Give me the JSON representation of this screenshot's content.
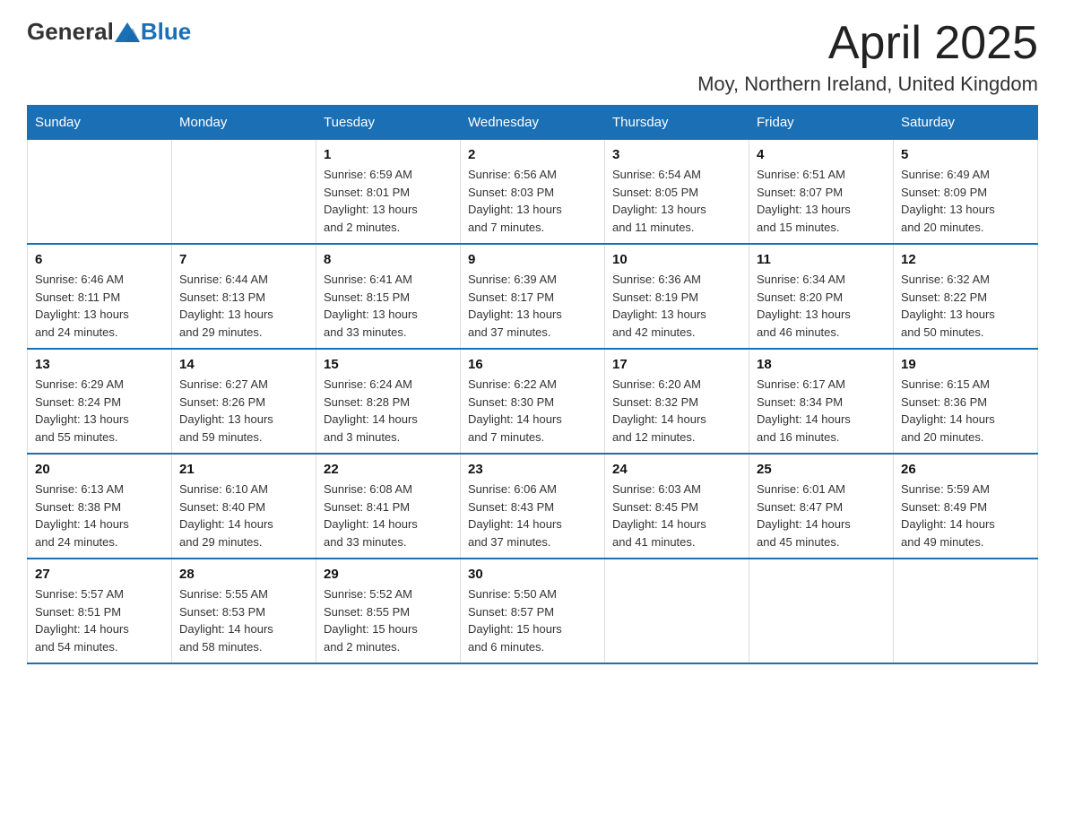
{
  "logo": {
    "text_general": "General",
    "text_blue": "Blue"
  },
  "header": {
    "title": "April 2025",
    "subtitle": "Moy, Northern Ireland, United Kingdom"
  },
  "weekdays": [
    "Sunday",
    "Monday",
    "Tuesday",
    "Wednesday",
    "Thursday",
    "Friday",
    "Saturday"
  ],
  "weeks": [
    [
      {
        "day": "",
        "info": ""
      },
      {
        "day": "",
        "info": ""
      },
      {
        "day": "1",
        "info": "Sunrise: 6:59 AM\nSunset: 8:01 PM\nDaylight: 13 hours\nand 2 minutes."
      },
      {
        "day": "2",
        "info": "Sunrise: 6:56 AM\nSunset: 8:03 PM\nDaylight: 13 hours\nand 7 minutes."
      },
      {
        "day": "3",
        "info": "Sunrise: 6:54 AM\nSunset: 8:05 PM\nDaylight: 13 hours\nand 11 minutes."
      },
      {
        "day": "4",
        "info": "Sunrise: 6:51 AM\nSunset: 8:07 PM\nDaylight: 13 hours\nand 15 minutes."
      },
      {
        "day": "5",
        "info": "Sunrise: 6:49 AM\nSunset: 8:09 PM\nDaylight: 13 hours\nand 20 minutes."
      }
    ],
    [
      {
        "day": "6",
        "info": "Sunrise: 6:46 AM\nSunset: 8:11 PM\nDaylight: 13 hours\nand 24 minutes."
      },
      {
        "day": "7",
        "info": "Sunrise: 6:44 AM\nSunset: 8:13 PM\nDaylight: 13 hours\nand 29 minutes."
      },
      {
        "day": "8",
        "info": "Sunrise: 6:41 AM\nSunset: 8:15 PM\nDaylight: 13 hours\nand 33 minutes."
      },
      {
        "day": "9",
        "info": "Sunrise: 6:39 AM\nSunset: 8:17 PM\nDaylight: 13 hours\nand 37 minutes."
      },
      {
        "day": "10",
        "info": "Sunrise: 6:36 AM\nSunset: 8:19 PM\nDaylight: 13 hours\nand 42 minutes."
      },
      {
        "day": "11",
        "info": "Sunrise: 6:34 AM\nSunset: 8:20 PM\nDaylight: 13 hours\nand 46 minutes."
      },
      {
        "day": "12",
        "info": "Sunrise: 6:32 AM\nSunset: 8:22 PM\nDaylight: 13 hours\nand 50 minutes."
      }
    ],
    [
      {
        "day": "13",
        "info": "Sunrise: 6:29 AM\nSunset: 8:24 PM\nDaylight: 13 hours\nand 55 minutes."
      },
      {
        "day": "14",
        "info": "Sunrise: 6:27 AM\nSunset: 8:26 PM\nDaylight: 13 hours\nand 59 minutes."
      },
      {
        "day": "15",
        "info": "Sunrise: 6:24 AM\nSunset: 8:28 PM\nDaylight: 14 hours\nand 3 minutes."
      },
      {
        "day": "16",
        "info": "Sunrise: 6:22 AM\nSunset: 8:30 PM\nDaylight: 14 hours\nand 7 minutes."
      },
      {
        "day": "17",
        "info": "Sunrise: 6:20 AM\nSunset: 8:32 PM\nDaylight: 14 hours\nand 12 minutes."
      },
      {
        "day": "18",
        "info": "Sunrise: 6:17 AM\nSunset: 8:34 PM\nDaylight: 14 hours\nand 16 minutes."
      },
      {
        "day": "19",
        "info": "Sunrise: 6:15 AM\nSunset: 8:36 PM\nDaylight: 14 hours\nand 20 minutes."
      }
    ],
    [
      {
        "day": "20",
        "info": "Sunrise: 6:13 AM\nSunset: 8:38 PM\nDaylight: 14 hours\nand 24 minutes."
      },
      {
        "day": "21",
        "info": "Sunrise: 6:10 AM\nSunset: 8:40 PM\nDaylight: 14 hours\nand 29 minutes."
      },
      {
        "day": "22",
        "info": "Sunrise: 6:08 AM\nSunset: 8:41 PM\nDaylight: 14 hours\nand 33 minutes."
      },
      {
        "day": "23",
        "info": "Sunrise: 6:06 AM\nSunset: 8:43 PM\nDaylight: 14 hours\nand 37 minutes."
      },
      {
        "day": "24",
        "info": "Sunrise: 6:03 AM\nSunset: 8:45 PM\nDaylight: 14 hours\nand 41 minutes."
      },
      {
        "day": "25",
        "info": "Sunrise: 6:01 AM\nSunset: 8:47 PM\nDaylight: 14 hours\nand 45 minutes."
      },
      {
        "day": "26",
        "info": "Sunrise: 5:59 AM\nSunset: 8:49 PM\nDaylight: 14 hours\nand 49 minutes."
      }
    ],
    [
      {
        "day": "27",
        "info": "Sunrise: 5:57 AM\nSunset: 8:51 PM\nDaylight: 14 hours\nand 54 minutes."
      },
      {
        "day": "28",
        "info": "Sunrise: 5:55 AM\nSunset: 8:53 PM\nDaylight: 14 hours\nand 58 minutes."
      },
      {
        "day": "29",
        "info": "Sunrise: 5:52 AM\nSunset: 8:55 PM\nDaylight: 15 hours\nand 2 minutes."
      },
      {
        "day": "30",
        "info": "Sunrise: 5:50 AM\nSunset: 8:57 PM\nDaylight: 15 hours\nand 6 minutes."
      },
      {
        "day": "",
        "info": ""
      },
      {
        "day": "",
        "info": ""
      },
      {
        "day": "",
        "info": ""
      }
    ]
  ]
}
